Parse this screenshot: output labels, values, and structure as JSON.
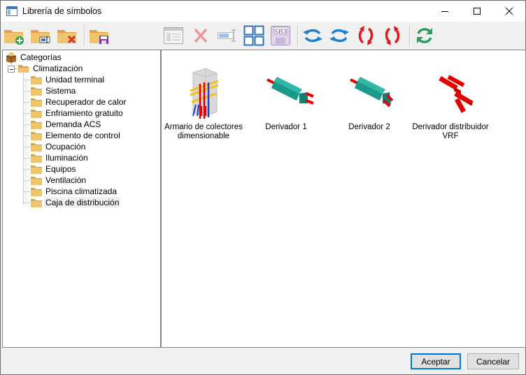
{
  "window": {
    "title": "Librería de símbolos"
  },
  "window_controls": [
    "minimize-icon",
    "maximize-icon",
    "close-icon"
  ],
  "toolbar": {
    "buttons": [
      {
        "icon": "folder-add-icon"
      },
      {
        "icon": "folder-rename-icon"
      },
      {
        "icon": "folder-delete-icon"
      },
      {
        "icon": "folder-save-icon"
      },
      {
        "icon": "window-list-icon"
      },
      {
        "icon": "delete-x-icon"
      },
      {
        "icon": "rename-field-icon"
      },
      {
        "icon": "grid-view-icon"
      },
      {
        "icon": "sb3-save-icon",
        "text": "SB3"
      },
      {
        "icon": "rotate-left-icon"
      },
      {
        "icon": "rotate-right-icon"
      },
      {
        "icon": "flip-vertical-icon"
      },
      {
        "icon": "flip-vertical-alt-icon"
      },
      {
        "icon": "refresh-icon"
      }
    ]
  },
  "tree": {
    "root": "Categorías",
    "group": "Climatización",
    "items": [
      "Unidad terminal",
      "Sistema",
      "Recuperador de calor",
      "Enfriamiento gratuito",
      "Demanda ACS",
      "Elemento de control",
      "Ocupación",
      "Iluminación",
      "Equipos",
      "Ventilación",
      "Piscina climatizada",
      "Caja de distribución"
    ],
    "selected": "Caja de distribución"
  },
  "symbols": [
    {
      "label": "Armario de colectores dimensionable",
      "icon": "collector-cabinet-icon"
    },
    {
      "label": "Derivador 1",
      "icon": "branch-1-icon"
    },
    {
      "label": "Derivador 2",
      "icon": "branch-2-icon"
    },
    {
      "label": "Derivador distribuidor VRF",
      "icon": "vrf-distributor-icon"
    }
  ],
  "buttons": {
    "ok": "Aceptar",
    "cancel": "Cancelar"
  },
  "colors": {
    "folder": "#e8b867",
    "accent": "#0078d7",
    "pipe_red": "#e60000",
    "teal": "#1b9a8c"
  }
}
